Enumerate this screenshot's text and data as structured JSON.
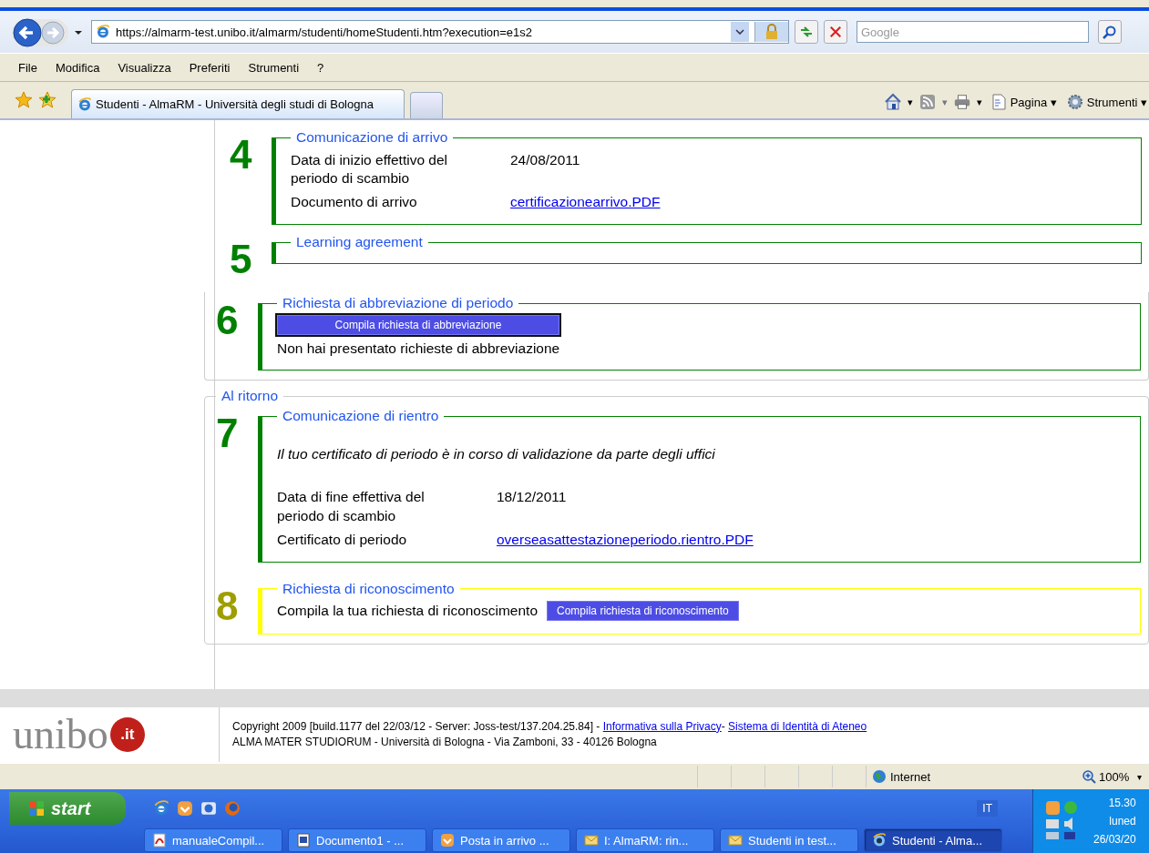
{
  "browser": {
    "address": "https://almarm-test.unibo.it/almarm/studenti/homeStudenti.htm?execution=e1s2",
    "search": {
      "placeholder": "Google"
    },
    "menu": [
      "File",
      "Modifica",
      "Visualizza",
      "Preferiti",
      "Strumenti",
      "?"
    ],
    "tab_title": "Studenti - AlmaRM - Università degli studi di Bologna",
    "icon_carets": [
      "▾",
      "▾",
      "▾"
    ],
    "commands": [
      {
        "label": "Pagina",
        "caret": "▾"
      },
      {
        "label": "Strumenti",
        "caret": "▾"
      }
    ]
  },
  "page": {
    "top_sections": [
      {
        "number": "4",
        "color": "#008000",
        "title": "Comunicazione di arrivo",
        "items": [
          {
            "kind": "field",
            "label": "Data di inizio effettivo del periodo di scambio",
            "value": "24/08/2011",
            "link": false
          },
          {
            "kind": "field",
            "label": "Documento di arrivo",
            "value": "certificazionearrivo.PDF",
            "link": true
          }
        ]
      },
      {
        "number": "5",
        "color": "#008000",
        "title": "Learning agreement"
      }
    ],
    "groups": [
      {
        "clipped_top": true,
        "sections": [
          {
            "number": "6",
            "color": "#008000",
            "title": "Richiesta di abbreviazione di periodo",
            "items": [
              {
                "kind": "button",
                "label": "Compila richiesta di abbreviazione",
                "focused": true
              },
              {
                "kind": "text",
                "text": "Non hai presentato richieste di abbreviazione"
              }
            ]
          }
        ]
      },
      {
        "clipped_top": false,
        "title": "Al ritorno",
        "sections": [
          {
            "number": "7",
            "color": "#008000",
            "title": "Comunicazione di rientro",
            "items": [
              {
                "kind": "message",
                "text": "Il tuo certificato di periodo è in corso di validazione da parte degli uffici"
              },
              {
                "kind": "field",
                "label": "Data di fine effettiva del periodo di scambio",
                "value": "18/12/2011",
                "link": false
              },
              {
                "kind": "field",
                "label": "Certificato di periodo",
                "value": "overseasattestazioneperiodo.rientro.PDF",
                "link": true
              }
            ]
          },
          {
            "number": "8",
            "color": "#ffff00",
            "title": "Richiesta di riconoscimento",
            "items": [
              {
                "kind": "action",
                "text": "Compila la tua richiesta di riconoscimento",
                "button": "Compila richiesta di riconoscimento"
              }
            ]
          }
        ]
      }
    ]
  },
  "footer": {
    "logo": {
      "word": "unibo",
      "badge": ".it"
    },
    "line1": {
      "text": "Copyright 2009 [build.1177 del 22/03/12 - Server: Joss-test/137.204.25.84] - ",
      "links": [
        "Informativa sulla Privacy",
        "Sistema di Identità di Ateneo"
      ],
      "separator": "- "
    },
    "line2": "ALMA MATER STUDIORUM - Università di Bologna - Via Zamboni, 33 - 40126 Bologna"
  },
  "status_bar": {
    "zone": "Internet",
    "zoom": "100%",
    "zoom_caret": "▾"
  },
  "taskbar": {
    "start": "start",
    "language": "IT",
    "tasks": [
      {
        "kind": "pdf",
        "label": "manualeCompil...",
        "selected": false
      },
      {
        "kind": "doc",
        "label": "Documento1 - ...",
        "selected": false
      },
      {
        "kind": "mail",
        "label": "Posta in arrivo ...",
        "selected": false
      },
      {
        "kind": "envelope",
        "label": "I: AlmaRM: rin...",
        "selected": false
      },
      {
        "kind": "envelope",
        "label": "Studenti in test...",
        "selected": false
      },
      {
        "kind": "browser",
        "label": "Studenti - Alma...",
        "selected": true
      }
    ],
    "clock": {
      "time": "15.30",
      "day": "luned",
      "date": "26/03/20"
    }
  }
}
